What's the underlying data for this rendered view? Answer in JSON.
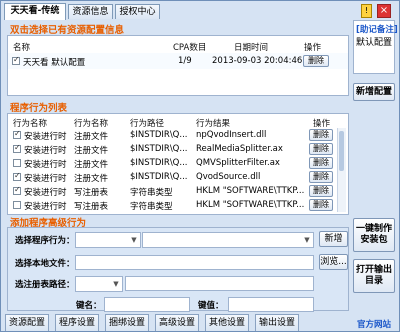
{
  "tabs": [
    "天天看-传统",
    "资源信息",
    "授权中心"
  ],
  "sections": {
    "config": "双击选择已有资源配置信息",
    "behaviors": "程序行为列表",
    "advanced": "添加程序高级行为"
  },
  "config_table": {
    "headers": [
      "名称",
      "CPA数目",
      "日期时间",
      "操作"
    ],
    "row": {
      "name": "天天看 默认配置",
      "cpa": "1/9",
      "datetime": "2013-09-03 20:04:46",
      "action": "删除"
    }
  },
  "behavior_table": {
    "headers": [
      "行为名称",
      "行为名称",
      "行为路径",
      "行为结果",
      "操作"
    ],
    "rows": [
      {
        "checked": true,
        "name": "安装进行时",
        "type": "注册文件",
        "path": "$INSTDIR\\Q...",
        "result": "npQvodInsert.dll",
        "action": "删除"
      },
      {
        "checked": true,
        "name": "安装进行时",
        "type": "注册文件",
        "path": "$INSTDIR\\Q...",
        "result": "RealMediaSplitter.ax",
        "action": "删除"
      },
      {
        "checked": false,
        "name": "安装进行时",
        "type": "注册文件",
        "path": "$INSTDIR\\Q...",
        "result": "QMVSplitterFilter.ax",
        "action": "删除"
      },
      {
        "checked": true,
        "name": "安装进行时",
        "type": "注册文件",
        "path": "$INSTDIR\\Q...",
        "result": "QvodSource.dll",
        "action": "删除"
      },
      {
        "checked": true,
        "name": "安装进行时",
        "type": "写注册表",
        "path": "字符串类型",
        "result": "HKLM \"SOFTWARE\\TTKP...",
        "action": "删除"
      },
      {
        "checked": false,
        "name": "安装进行时",
        "type": "写注册表",
        "path": "字符串类型",
        "result": "HKLM \"SOFTWARE\\TTKP...",
        "action": "删除"
      }
    ]
  },
  "form": {
    "select_behavior_label": "选择程序行为：",
    "local_file_label": "选择本地文件：",
    "registry_path_label": "选注册表路径：",
    "key_name_label": "键名：",
    "key_value_label": "键值：",
    "add_button": "新增",
    "browse_button": "浏览..."
  },
  "side": {
    "note_title": "[助记备注]",
    "note_text": "默认配置",
    "new_config": "新增配置",
    "one_click_line1": "一键制作",
    "one_click_line2": "安装包",
    "open_output_line1": "打开输出",
    "open_output_line2": "目录",
    "official_site": "官方网站"
  },
  "bottom_tabs": [
    "资源配置",
    "程序设置",
    "捆绑设置",
    "高级设置",
    "其他设置",
    "输出设置"
  ],
  "colors": {
    "accent": "#e85f00",
    "link": "#1a56c9"
  }
}
